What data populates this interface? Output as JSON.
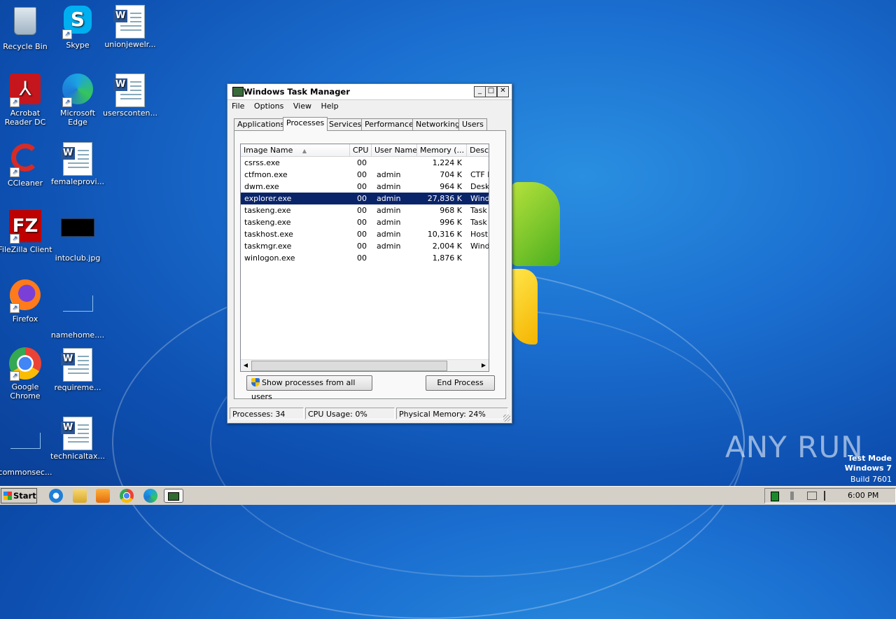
{
  "desktop": {
    "icons": [
      {
        "label": "Recycle Bin"
      },
      {
        "label": "Skype"
      },
      {
        "label": "unionjewelr..."
      },
      {
        "label": "Acrobat Reader DC"
      },
      {
        "label": "Microsoft Edge"
      },
      {
        "label": "usersconten..."
      },
      {
        "label": "CCleaner"
      },
      {
        "label": "femaleprovi..."
      },
      {
        "label": "FileZilla Client"
      },
      {
        "label": "intoclub.jpg"
      },
      {
        "label": "Firefox"
      },
      {
        "label": "namehome...."
      },
      {
        "label": "Google Chrome"
      },
      {
        "label": "requireme..."
      },
      {
        "label": "commonsec..."
      },
      {
        "label": "technicaltax..."
      }
    ]
  },
  "window": {
    "title": "Windows Task Manager",
    "buttons": {
      "minimize": "_",
      "maximize": "□",
      "close": "✕"
    },
    "menu": [
      "File",
      "Options",
      "View",
      "Help"
    ],
    "tabs": [
      "Applications",
      "Processes",
      "Services",
      "Performance",
      "Networking",
      "Users"
    ],
    "active_tab": "Processes",
    "columns": [
      "Image Name",
      "CPU",
      "User Name",
      "Memory (...",
      "Desc"
    ],
    "rows": [
      {
        "name": "csrss.exe",
        "cpu": "00",
        "user": "",
        "mem": "1,224 K",
        "desc": ""
      },
      {
        "name": "ctfmon.exe",
        "cpu": "00",
        "user": "admin",
        "mem": "704 K",
        "desc": "CTF L"
      },
      {
        "name": "dwm.exe",
        "cpu": "00",
        "user": "admin",
        "mem": "964 K",
        "desc": "Desk"
      },
      {
        "name": "explorer.exe",
        "cpu": "00",
        "user": "admin",
        "mem": "27,836 K",
        "desc": "Wind"
      },
      {
        "name": "taskeng.exe",
        "cpu": "00",
        "user": "admin",
        "mem": "968 K",
        "desc": "Task"
      },
      {
        "name": "taskeng.exe",
        "cpu": "00",
        "user": "admin",
        "mem": "996 K",
        "desc": "Task"
      },
      {
        "name": "taskhost.exe",
        "cpu": "00",
        "user": "admin",
        "mem": "10,316 K",
        "desc": "Host"
      },
      {
        "name": "taskmgr.exe",
        "cpu": "00",
        "user": "admin",
        "mem": "2,004 K",
        "desc": "Wind"
      },
      {
        "name": "winlogon.exe",
        "cpu": "00",
        "user": "",
        "mem": "1,876 K",
        "desc": ""
      }
    ],
    "selected_row": "explorer.exe",
    "show_all_label": "Show processes from all users",
    "end_process_label": "End Process",
    "status": {
      "processes": "Processes: 34",
      "cpu": "CPU Usage: 0%",
      "memory": "Physical Memory: 24%"
    }
  },
  "taskbar": {
    "start_label": "Start",
    "clock": "6:00 PM"
  },
  "watermark": {
    "brand": "ANY RUN",
    "line1": "Test Mode",
    "line2": "Windows 7",
    "line3": "Build 7601"
  }
}
